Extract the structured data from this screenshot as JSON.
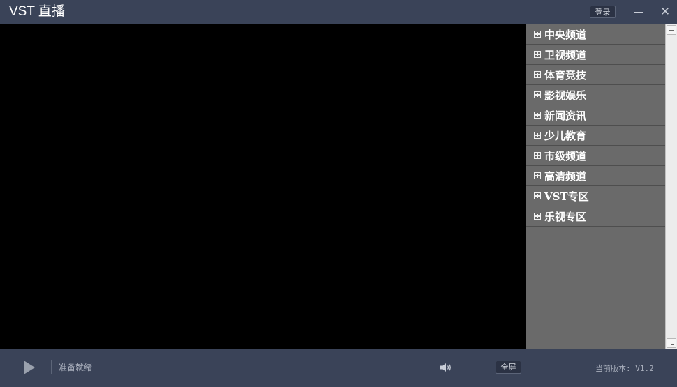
{
  "window": {
    "title": "VST 直播",
    "login_label": "登录",
    "minimize_icon": "minimize-icon",
    "close_icon": "close-icon",
    "close_glyph": "✕"
  },
  "categories": [
    {
      "label": "中央频道"
    },
    {
      "label": "卫视频道"
    },
    {
      "label": "体育竞技"
    },
    {
      "label": "影视娱乐"
    },
    {
      "label": "新闻资讯"
    },
    {
      "label": "少儿教育"
    },
    {
      "label": "市级频道"
    },
    {
      "label": "高清频道"
    },
    {
      "label": "VST专区"
    },
    {
      "label": "乐视专区"
    }
  ],
  "player": {
    "status": "准备就绪",
    "fullscreen_label": "全屏",
    "version": "当前版本: V1.2",
    "play_icon": "play-icon",
    "volume_icon": "volume-icon"
  },
  "colors": {
    "chrome": "#3a4358",
    "video": "#000000",
    "sidebar": "#6a6a6a"
  }
}
